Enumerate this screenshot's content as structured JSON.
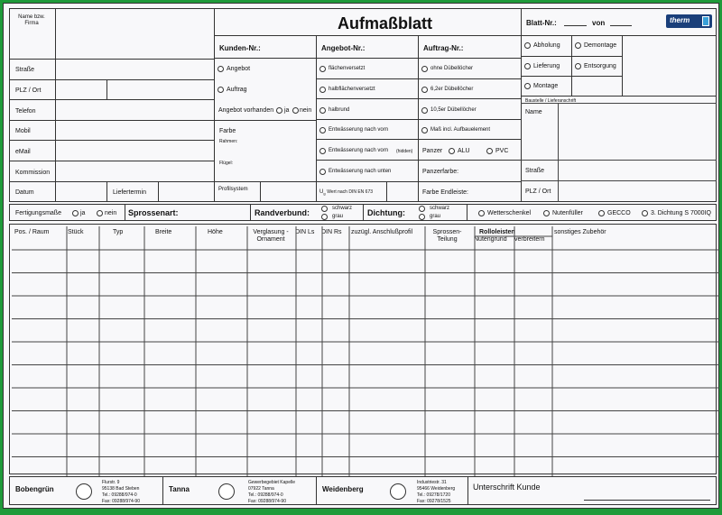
{
  "title": "Aufmaßblatt",
  "blatt": {
    "label": "Blatt-Nr.:",
    "von": "von"
  },
  "logo": "therm",
  "left": {
    "name": "Name bzw. Firma",
    "strasse": "Straße",
    "plz": "PLZ / Ort",
    "telefon": "Telefon",
    "mobil": "Mobil",
    "email": "eMail",
    "kommission": "Kommission",
    "datum": "Datum",
    "liefertermin": "Liefertermin"
  },
  "kunden": {
    "header": "Kunden-Nr.:",
    "angebot": "Angebot",
    "auftrag": "Auftrag",
    "vorhanden": "Angebot vorhanden",
    "ja": "ja",
    "nein": "nein",
    "farbe": "Farbe",
    "rahmen": "Rahmen:",
    "fluegel": "Flügel:",
    "profilsystem": "Profilsystem"
  },
  "angebot": {
    "header": "Angebot-Nr.:",
    "items": [
      "flächenversetzt",
      "halbflächenversetzt",
      "halbrund",
      "Entwässerung nach vorn",
      "Entwässerung nach vorn",
      "Entwässerung nach unten"
    ],
    "hidden": "(hidden)",
    "uw": "U",
    "uw_sub": "g",
    "uw_text": "Wert nach DIN EN 673"
  },
  "auftrag": {
    "header": "Auftrag-Nr.:",
    "items": [
      "ohne Dübellöcher",
      "6,2er Dübellöcher",
      "10,5er Dübellöcher",
      "Maß incl. Aufbauelement"
    ],
    "panzer": "Panzer",
    "alu": "ALU",
    "pvc": "PVC",
    "panzerfarbe": "Panzerfarbe:",
    "endleiste": "Farbe Endleiste:"
  },
  "options": [
    "Abholung",
    "Demontage",
    "Lieferung",
    "Entsorgung",
    "Montage"
  ],
  "baustelle": {
    "header": "Baustelle / Lieferanschrift",
    "name": "Name",
    "strasse": "Straße",
    "plz": "PLZ / Ort"
  },
  "row2": {
    "fertigung": "Fertigungsmaße",
    "ja": "ja",
    "nein": "nein",
    "sprossenart": "Sprossenart:",
    "randverbund": "Randverbund:",
    "schwarz": "schwarz",
    "grau": "grau",
    "dichtung": "Dichtung:",
    "wetter": "Wetterschenkel",
    "nutenfueller": "Nutenfüller",
    "gecco": "GECCO",
    "dichtung3": "3. Dichtung S 7000IQ"
  },
  "table": {
    "headers": [
      "Pos. / Raum",
      "Stück",
      "Typ",
      "Breite",
      "Höhe",
      "Verglasung - Ornament",
      "DIN Ls",
      "DIN Rs",
      "zuzügl. Anschlußprofil",
      "Sprossen- Teilung",
      "Nutengrund",
      "verbreitern",
      "sonstiges Zubehör"
    ],
    "rolleiste": "Rolloleisten"
  },
  "footer": {
    "loc1": {
      "name": "Bobengrün",
      "addr": [
        "Flurstr. 9",
        "95138 Bad Steben",
        "Tel.: 09288/974-0",
        "Fax: 09288/974-90"
      ]
    },
    "loc2": {
      "name": "Tanna",
      "addr": [
        "Gewerbegebiet Kapelle",
        "07922 Tanna",
        "Tel.: 09288/974-0",
        "Fax: 09288/974-90"
      ]
    },
    "loc3": {
      "name": "Weidenberg",
      "addr": [
        "Industriestr. 31",
        "95466 Weidenberg",
        "Tel.: 09278/1720",
        "Fax: 09278/1525"
      ]
    },
    "signature": "Unterschrift Kunde"
  }
}
